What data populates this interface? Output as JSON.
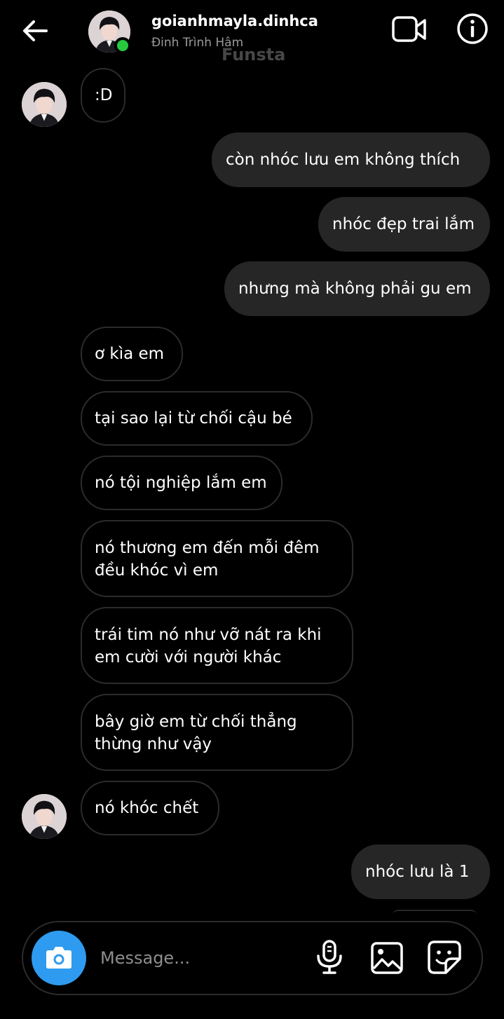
{
  "header": {
    "username": "goianhmayla.dinhca",
    "display_name": "Đinh Trình Hâm",
    "watermark": "Funsta",
    "back_icon": "arrow-left-icon",
    "video_icon": "video-camera-icon",
    "info_icon": "info-circle-icon",
    "online_color": "#27c93f"
  },
  "messages": [
    {
      "side": "in",
      "text": ":D"
    },
    {
      "side": "out",
      "text": "còn nhóc lưu em không thích"
    },
    {
      "side": "out",
      "text": "nhóc đẹp trai lắm"
    },
    {
      "side": "out",
      "text": "nhưng mà không phải gu em"
    },
    {
      "side": "in",
      "text": "ơ kìa em"
    },
    {
      "side": "in",
      "text": "tại sao lại từ chối cậu bé"
    },
    {
      "side": "in",
      "text": "nó tội nghiệp lắm em"
    },
    {
      "side": "in",
      "lines": [
        "nó thương em đến mỗi đêm",
        "đều khóc vì em"
      ]
    },
    {
      "side": "in",
      "lines": [
        "trái tim nó như vỡ nát ra khi",
        "em cười với người khác"
      ]
    },
    {
      "side": "in",
      "lines": [
        "bây giờ em từ chối thẳng",
        "thừng như vậy"
      ]
    },
    {
      "side": "in",
      "text": "nó khóc chết"
    },
    {
      "side": "out",
      "text": "nhóc lưu là 1"
    }
  ],
  "composer": {
    "placeholder": "Message...",
    "camera_icon": "camera-icon",
    "mic_icon": "microphone-icon",
    "gallery_icon": "image-icon",
    "sticker_icon": "sticker-icon",
    "camera_color": "#2e9bf0"
  },
  "colors": {
    "background": "#000000",
    "outgoing_bubble": "#262626",
    "incoming_border": "#2b2b2b"
  }
}
